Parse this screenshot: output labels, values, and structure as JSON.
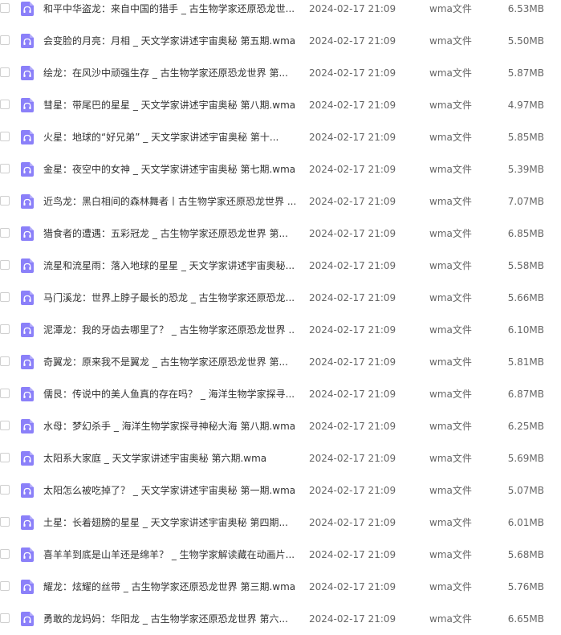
{
  "icon_color": "#8b80f9",
  "file_icon": "audio-file-icon",
  "files": [
    {
      "name": "和平中华盗龙：来自中国的猎手 _ 古生物学家还原恐龙世...",
      "date": "2024-02-17 21:09",
      "type": "wma文件",
      "size": "6.53MB"
    },
    {
      "name": "会变脸的月亮：月相 _ 天文学家讲述宇宙奥秘 第五期.wma",
      "date": "2024-02-17 21:09",
      "type": "wma文件",
      "size": "5.50MB"
    },
    {
      "name": "绘龙：在风沙中顽强生存 _ 古生物学家还原恐龙世界 第...",
      "date": "2024-02-17 21:09",
      "type": "wma文件",
      "size": "5.87MB"
    },
    {
      "name": "彗星：带尾巴的星星 _ 天文学家讲述宇宙奥秘 第八期.wma",
      "date": "2024-02-17 21:09",
      "type": "wma文件",
      "size": "4.97MB"
    },
    {
      "name": "火星：地球的“好兄弟” _ 天文学家讲述宇宙奥秘 第十...",
      "date": "2024-02-17 21:09",
      "type": "wma文件",
      "size": "5.85MB"
    },
    {
      "name": "金星：夜空中的女神 _ 天文学家讲述宇宙奥秘 第七期.wma",
      "date": "2024-02-17 21:09",
      "type": "wma文件",
      "size": "5.39MB"
    },
    {
      "name": "近鸟龙：黑白相间的森林舞者丨古生物学家还原恐龙世界 ...",
      "date": "2024-02-17 21:09",
      "type": "wma文件",
      "size": "7.07MB"
    },
    {
      "name": "猎食者的遭遇：五彩冠龙 _ 古生物学家还原恐龙世界 第...",
      "date": "2024-02-17 21:09",
      "type": "wma文件",
      "size": "6.85MB"
    },
    {
      "name": "流星和流星雨：落入地球的星星 _ 天文学家讲述宇宙奥秘...",
      "date": "2024-02-17 21:09",
      "type": "wma文件",
      "size": "5.58MB"
    },
    {
      "name": "马门溪龙：世界上脖子最长的恐龙 _ 古生物学家还原恐龙...",
      "date": "2024-02-17 21:09",
      "type": "wma文件",
      "size": "5.66MB"
    },
    {
      "name": "泥潭龙：我的牙齿去哪里了？ _ 古生物学家还原恐龙世界 ...",
      "date": "2024-02-17 21:09",
      "type": "wma文件",
      "size": "6.10MB"
    },
    {
      "name": "奇翼龙：原来我不是翼龙 _ 古生物学家还原恐龙世界 第...",
      "date": "2024-02-17 21:09",
      "type": "wma文件",
      "size": "5.81MB"
    },
    {
      "name": "儒艮：传说中的美人鱼真的存在吗？ _ 海洋生物学家探寻...",
      "date": "2024-02-17 21:09",
      "type": "wma文件",
      "size": "6.87MB"
    },
    {
      "name": "水母：梦幻杀手 _ 海洋生物学家探寻神秘大海 第八期.wma",
      "date": "2024-02-17 21:09",
      "type": "wma文件",
      "size": "6.25MB"
    },
    {
      "name": "太阳系大家庭 _ 天文学家讲述宇宙奥秘 第六期.wma",
      "date": "2024-02-17 21:09",
      "type": "wma文件",
      "size": "5.69MB"
    },
    {
      "name": "太阳怎么被吃掉了？ _ 天文学家讲述宇宙奥秘 第一期.wma",
      "date": "2024-02-17 21:09",
      "type": "wma文件",
      "size": "5.07MB"
    },
    {
      "name": "土星：长着翅膀的星星 _ 天文学家讲述宇宙奥秘 第四期...",
      "date": "2024-02-17 21:09",
      "type": "wma文件",
      "size": "6.01MB"
    },
    {
      "name": "喜羊羊到底是山羊还是绵羊？ _ 生物学家解读藏在动画片...",
      "date": "2024-02-17 21:09",
      "type": "wma文件",
      "size": "5.68MB"
    },
    {
      "name": "耀龙：炫耀的丝带 _ 古生物学家还原恐龙世界 第三期.wma",
      "date": "2024-02-17 21:09",
      "type": "wma文件",
      "size": "5.76MB"
    },
    {
      "name": "勇敢的龙妈妈：华阳龙 _ 古生物学家还原恐龙世界 第六...",
      "date": "2024-02-17 21:09",
      "type": "wma文件",
      "size": "6.65MB"
    }
  ]
}
